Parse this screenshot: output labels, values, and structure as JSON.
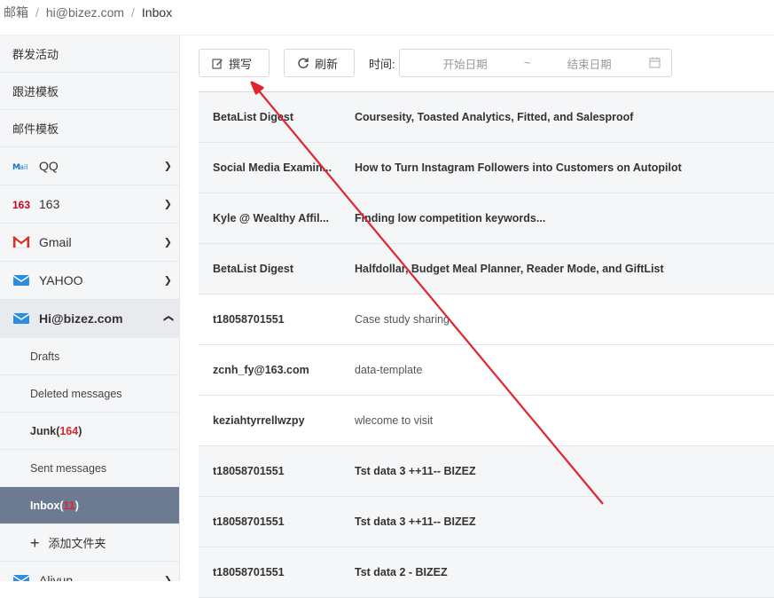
{
  "breadcrumb": [
    "邮箱",
    "hi@bizez.com",
    "Inbox"
  ],
  "sidebar": {
    "top_items": [
      "群发活动",
      "跟进模板",
      "邮件模板"
    ],
    "accounts": [
      {
        "label": "QQ",
        "icon": "qq-mail-icon"
      },
      {
        "label": "163",
        "icon": "163-icon"
      },
      {
        "label": "Gmail",
        "icon": "gmail-icon"
      },
      {
        "label": "YAHOO",
        "icon": "yahoo-mail-icon"
      }
    ],
    "current_account": {
      "label": "Hi@bizez.com",
      "icon": "mail-envelope-icon"
    },
    "folders": {
      "drafts": "Drafts",
      "deleted": "Deleted messages",
      "junk": "Junk",
      "junk_count": "164",
      "sent": "Sent messages",
      "inbox": "Inbox",
      "inbox_count": "11"
    },
    "add_folder": "添加文件夹",
    "next_account": "Aliyun"
  },
  "toolbar": {
    "compose_label": "撰写",
    "refresh_label": "刷新",
    "time_label": "时间:",
    "start_placeholder": "开始日期",
    "range_separator": "~",
    "end_placeholder": "结束日期"
  },
  "mails": [
    {
      "from": "BetaList Digest",
      "subject": "Coursesity, Toasted Analytics, Fitted, and Salesproof",
      "unread": true
    },
    {
      "from": "Social Media Examin...",
      "subject": "How to Turn Instagram Followers into Customers on Autopilot",
      "unread": true
    },
    {
      "from": "Kyle @ Wealthy Affil...",
      "subject": "Finding low competition keywords...",
      "unread": true
    },
    {
      "from": "BetaList Digest",
      "subject": "Halfdollar, Budget Meal Planner, Reader Mode, and GiftList",
      "unread": true
    },
    {
      "from": "t18058701551",
      "subject": "Case study sharing",
      "unread": false
    },
    {
      "from": "zcnh_fy@163.com",
      "subject": "data-template",
      "unread": false
    },
    {
      "from": "keziahtyrrellwzpy",
      "subject": "wlecome to visit",
      "unread": false
    },
    {
      "from": "t18058701551",
      "subject": "Tst data 3 ++11-- BIZEZ",
      "unread": true
    },
    {
      "from": "t18058701551",
      "subject": "Tst data 3 ++11-- BIZEZ",
      "unread": true
    },
    {
      "from": "t18058701551",
      "subject": "Tst data 2 - BIZEZ",
      "unread": true
    }
  ],
  "colors": {
    "accent_active": "#6c7a92",
    "count_red": "#e0262c",
    "arrow_red": "#e0262c"
  }
}
